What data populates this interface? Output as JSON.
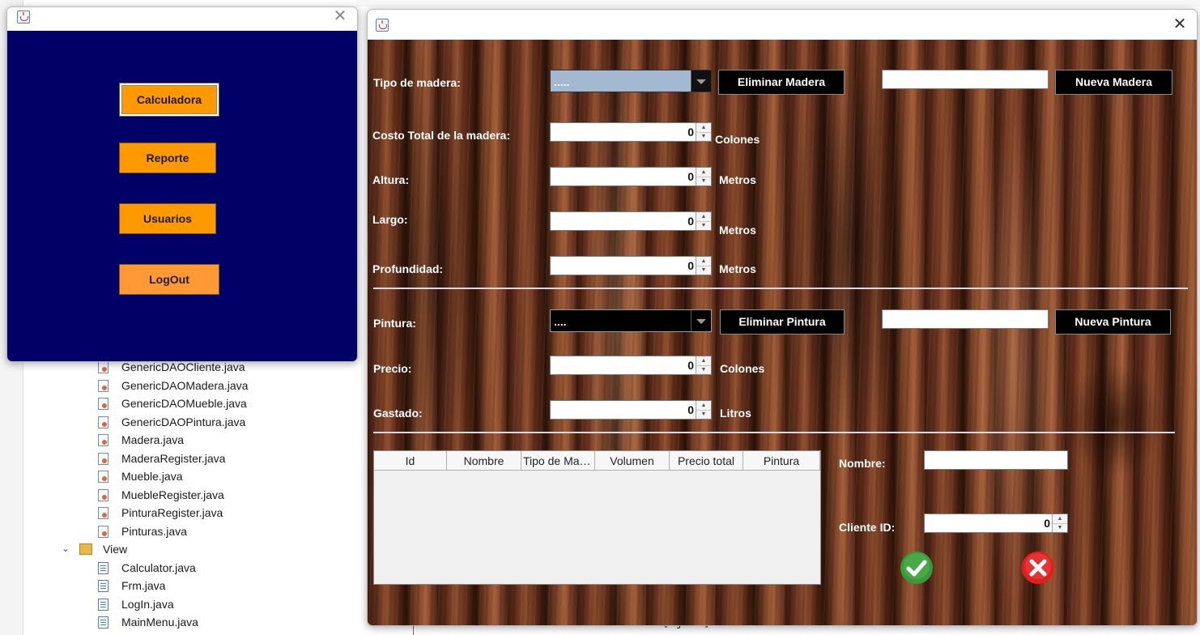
{
  "ide": {
    "tree": [
      {
        "label": "GenericDAOCliente.java",
        "kind": "java"
      },
      {
        "label": "GenericDAOMadera.java",
        "kind": "java"
      },
      {
        "label": "GenericDAOMueble.java",
        "kind": "java"
      },
      {
        "label": "GenericDAOPintura.java",
        "kind": "java"
      },
      {
        "label": "Madera.java",
        "kind": "java"
      },
      {
        "label": "MaderaRegister.java",
        "kind": "java"
      },
      {
        "label": "Mueble.java",
        "kind": "java"
      },
      {
        "label": "MuebleRegister.java",
        "kind": "java"
      },
      {
        "label": "PinturaRegister.java",
        "kind": "java"
      },
      {
        "label": "Pinturas.java",
        "kind": "java"
      },
      {
        "label": "View",
        "kind": "package"
      },
      {
        "label": "Calculator.java",
        "kind": "view"
      },
      {
        "label": "Frm.java",
        "kind": "view"
      },
      {
        "label": "LogIn.java",
        "kind": "view"
      },
      {
        "label": "MainMenu.java",
        "kind": "view"
      }
    ],
    "jar_text": "[ jar ]"
  },
  "menu_window": {
    "close_symbol": "✕",
    "buttons": {
      "calculadora": "Calculadora",
      "reporte": "Reporte",
      "usuarios": "Usuarios",
      "logout": "LogOut"
    },
    "colors": {
      "background": "#000066",
      "button": "#ff9900"
    }
  },
  "calc_window": {
    "close_symbol": "✕",
    "labels": {
      "tipo_madera": "Tipo de madera:",
      "costo_total": "Costo Total de la madera:",
      "altura": "Altura:",
      "largo": "Largo:",
      "profundidad": "Profundidad:",
      "pintura": "Pintura:",
      "precio": "Precio:",
      "gastado": "Gastado:",
      "nombre": "Nombre:",
      "cliente_id": "Cliente ID:"
    },
    "units": {
      "costo_total": "Colones",
      "altura": "Metros",
      "largo": "Metros",
      "profundidad": "Metros",
      "precio": "Colones",
      "gastado": "Litros"
    },
    "values": {
      "tipo_madera_selected": ".....",
      "pintura_selected": "....",
      "costo_total": "0",
      "altura": "0",
      "largo": "0",
      "profundidad": "0",
      "precio": "0",
      "gastado": "0",
      "cliente_id": "0",
      "nueva_madera_text": "",
      "nueva_pintura_text": "",
      "nombre_text": ""
    },
    "buttons": {
      "eliminar_madera": "Eliminar Madera",
      "nueva_madera": "Nueva Madera",
      "eliminar_pintura": "Eliminar Pintura",
      "nueva_pintura": "Nueva Pintura"
    },
    "table": {
      "columns": [
        "Id",
        "Nombre",
        "Tipo de Mad...",
        "Volumen",
        "Precio total",
        "Pintura"
      ],
      "rows": []
    },
    "colors": {
      "madera_combo": "#a3b8d1",
      "pintura_combo": "#000000",
      "accept": "#3a9a3a",
      "cancel": "#e02020"
    }
  }
}
